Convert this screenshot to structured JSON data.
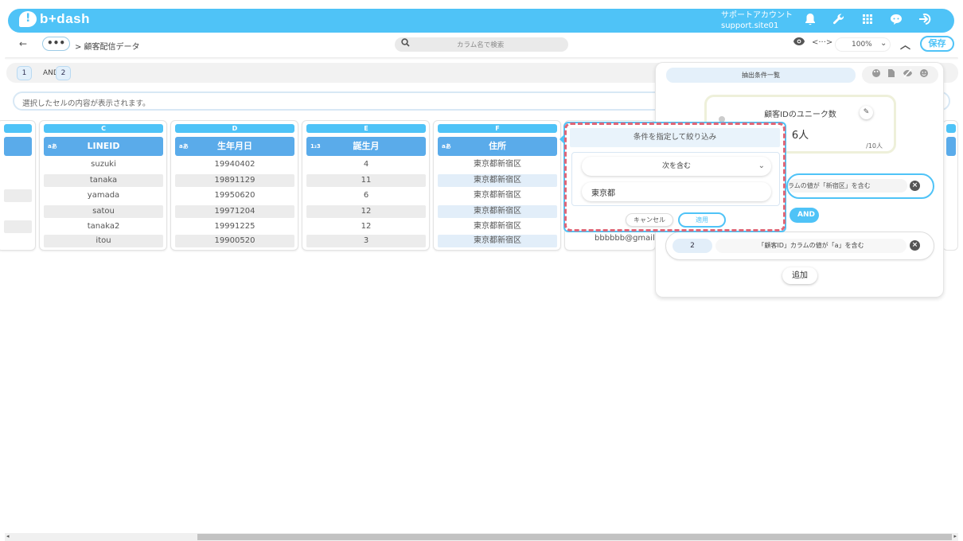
{
  "app": {
    "logo": "b+dash"
  },
  "account": {
    "role": "サポートアカウント",
    "site": "support.site01"
  },
  "header_icons": [
    "bell-icon",
    "wrench-icon",
    "grid-icon",
    "chat-bot-icon",
    "logout-icon"
  ],
  "nav": {
    "back": "←",
    "more": "•••",
    "breadcrumb": "> 顧客配信データ"
  },
  "search": {
    "placeholder": "カラム名で検索"
  },
  "toolbar": {
    "code": "<···>",
    "zoom": "100%",
    "save": "保存"
  },
  "conditions": {
    "chips": [
      "1",
      "2"
    ],
    "op": "AND"
  },
  "cell_display": {
    "placeholder": "選択したセルの内容が表示されます。"
  },
  "columns": [
    {
      "letter": "C",
      "type": "aあ",
      "name": "LINEID",
      "cells": [
        "suzuki",
        "tanaka",
        "yamada",
        "satou",
        "tanaka2",
        "itou"
      ]
    },
    {
      "letter": "D",
      "type": "aあ",
      "name": "生年月日",
      "cells": [
        "19940402",
        "19891129",
        "19950620",
        "19971204",
        "19991225",
        "19900520"
      ]
    },
    {
      "letter": "E",
      "type": "1₂3",
      "name": "誕生月",
      "cells": [
        "4",
        "11",
        "6",
        "12",
        "12",
        "3"
      ]
    },
    {
      "letter": "F",
      "type": "aあ",
      "name": "住所",
      "cells": [
        "東京都新宿区",
        "東京都新宿区",
        "東京都新宿区",
        "東京都新宿区",
        "東京都新宿区",
        "東京都新宿区"
      ]
    }
  ],
  "filter": {
    "title": "条件を指定して絞り込み",
    "operator": "次を含む",
    "value": "東京都",
    "cancel": "キャンセル",
    "apply": "適用"
  },
  "partial_email": "bbbbbb@gmail.co",
  "panel": {
    "tab": "抽出条件一覧",
    "unique_title": "顧客IDのユニーク数",
    "unique_value": "6人",
    "unique_total": "/10人",
    "rule1_text": "ラムの値が「新宿区」を含む",
    "and": "AND",
    "rule2_num": "2",
    "rule2_text": "「顧客ID」カラムの値が「a」を含む",
    "add": "追加"
  },
  "colors": {
    "accent": "#4fc3f7",
    "header": "#5aabea",
    "highlight": "#e06677"
  }
}
